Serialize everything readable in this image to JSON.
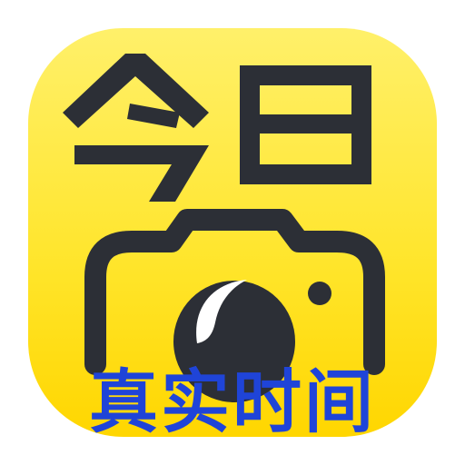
{
  "app": {
    "logo_text": "今日",
    "caption": "真实时间",
    "icon": "camera-icon"
  },
  "colors": {
    "background": "#ffffff",
    "icon_yellow": "#ffe94a",
    "icon_yellow_dark": "#ffd600",
    "logo_dark": "#2c2f36",
    "caption_blue": "#1f44d8",
    "lens_inner": "#ffffff"
  }
}
